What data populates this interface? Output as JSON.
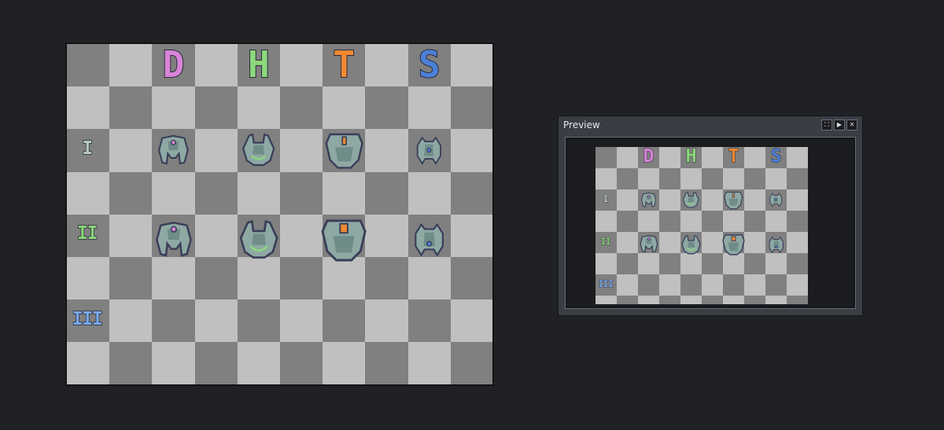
{
  "columns": [
    {
      "letter": "D",
      "color": "#d884d8"
    },
    {
      "letter": "H",
      "color": "#8cd87c"
    },
    {
      "letter": "T",
      "color": "#f08832"
    },
    {
      "letter": "S",
      "color": "#4c80d8"
    }
  ],
  "rows": [
    {
      "label": "I",
      "color": "#b8c8c4"
    },
    {
      "label": "II",
      "color": "#88d478"
    },
    {
      "label": "III",
      "color": "#78a8e8"
    }
  ],
  "checker": {
    "dark": "#808080",
    "light": "#c0c0c0"
  },
  "ship_colors": {
    "hull": "#8ea8a4",
    "outline": "#3a3e58",
    "shade": "#6f8c88"
  },
  "sprites": [
    {
      "type": "drone",
      "color": "#d884d8",
      "tier": "I"
    },
    {
      "type": "hunter",
      "color": "#8cd87c",
      "tier": "I"
    },
    {
      "type": "tank",
      "color": "#f08832",
      "tier": "I"
    },
    {
      "type": "scout",
      "color": "#4c80d8",
      "tier": "I"
    },
    {
      "type": "drone",
      "color": "#d884d8",
      "tier": "II"
    },
    {
      "type": "hunter",
      "color": "#8cd87c",
      "tier": "II"
    },
    {
      "type": "tank",
      "color": "#f08832",
      "tier": "II"
    },
    {
      "type": "scout",
      "color": "#4c80d8",
      "tier": "II"
    }
  ],
  "preview": {
    "title": "Preview",
    "buttons": [
      "⛶",
      "▶",
      "✕"
    ]
  }
}
